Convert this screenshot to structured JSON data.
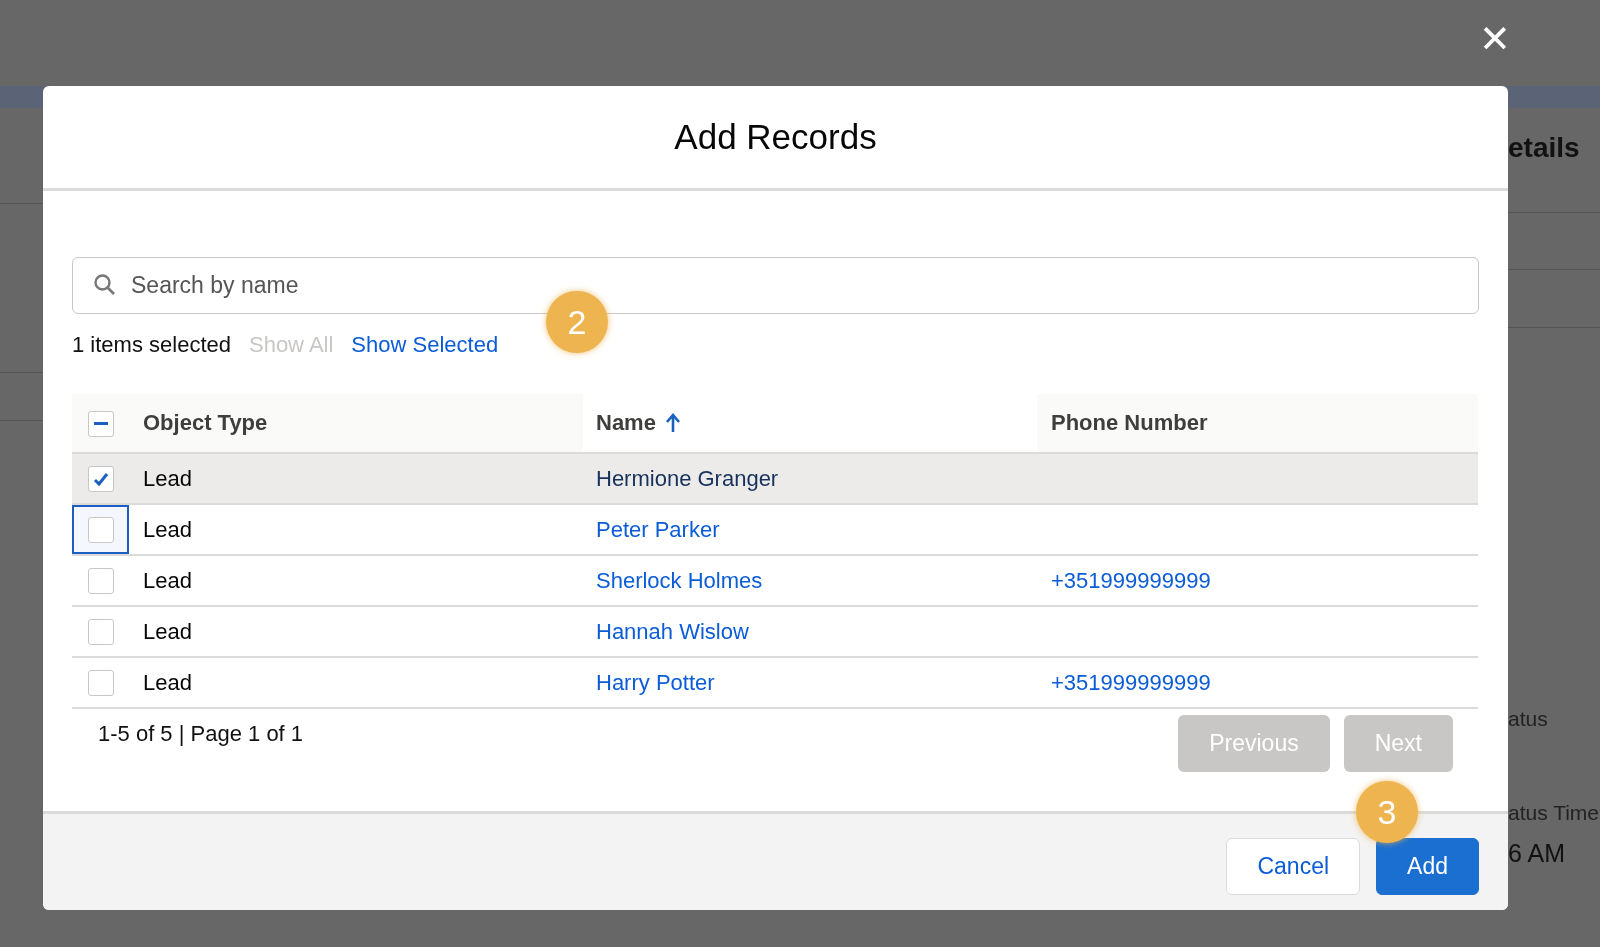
{
  "background": {
    "heading": "etails",
    "fields": [
      {
        "label": "atus"
      },
      {
        "label": "atus Time",
        "value": "6 AM"
      }
    ]
  },
  "dialog": {
    "title": "Add Records",
    "close": "✕",
    "search": {
      "placeholder": "Search by name"
    },
    "selection": {
      "count": "1 items selected",
      "links": [
        {
          "label": "Show All",
          "disabled": true
        },
        {
          "label": "Show Selected",
          "disabled": false
        }
      ]
    },
    "table": {
      "select_all": {
        "indeterminate": true
      },
      "columns": [
        {
          "label": "Object Type",
          "sorted": false
        },
        {
          "label": "Name",
          "sorted": true
        },
        {
          "label": "Phone Number",
          "sorted": false
        }
      ],
      "rows": [
        {
          "object_type": "Lead",
          "name": "Hermione Granger",
          "selected": true,
          "focused": false
        },
        {
          "object_type": "Lead",
          "name": "Peter Parker",
          "selected": false,
          "focused": true
        },
        {
          "object_type": "Lead",
          "name": "Sherlock Holmes",
          "phone": "+351999999999",
          "selected": false,
          "focused": false
        },
        {
          "object_type": "Lead",
          "name": "Hannah Wislow",
          "selected": false,
          "focused": false
        },
        {
          "object_type": "Lead",
          "name": "Harry Potter",
          "phone": "+351999999999",
          "selected": false,
          "focused": false
        }
      ]
    },
    "pagination": {
      "summary": "1-5 of 5 | Page 1 of 1",
      "buttons": [
        {
          "label": "Previous",
          "disabled": true
        },
        {
          "label": "Next",
          "disabled": true
        }
      ]
    },
    "buttons": [
      {
        "label": "Cancel",
        "kind": "neutral"
      },
      {
        "label": "Add",
        "kind": "brand"
      }
    ]
  },
  "step_badges": [
    {
      "label": "2"
    },
    {
      "label": "3"
    }
  ]
}
